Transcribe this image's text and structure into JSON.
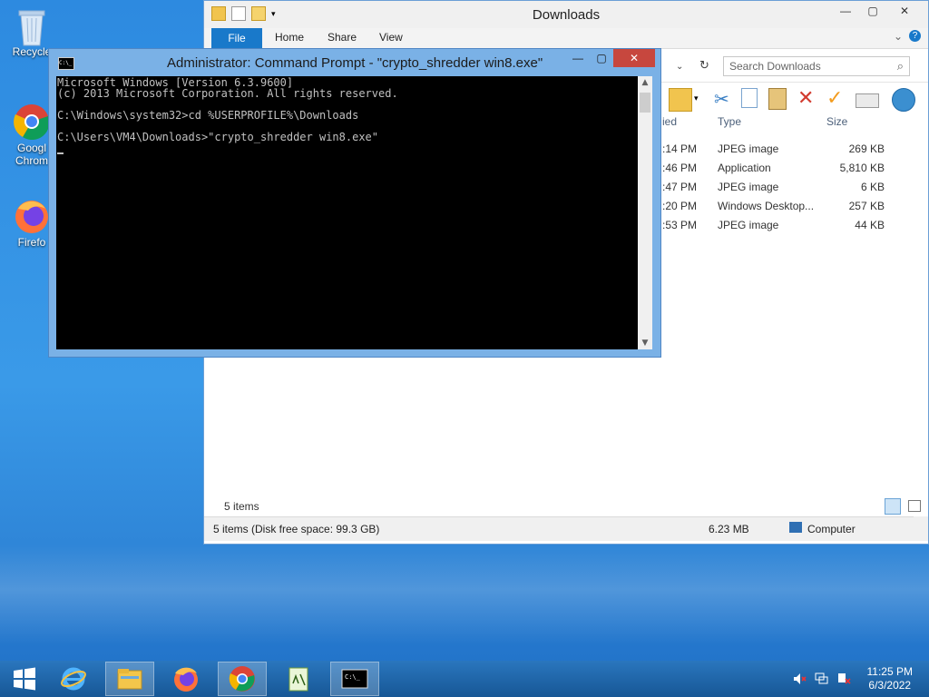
{
  "desktop": {
    "icons": [
      {
        "label": "Recycle",
        "icon": "recycle-bin-icon"
      },
      {
        "label": "Googl\nChrom",
        "icon": "chrome-icon"
      },
      {
        "label": "Firefo",
        "icon": "firefox-icon"
      }
    ]
  },
  "explorer": {
    "title": "Downloads",
    "ribbon": {
      "file": "File",
      "home": "Home",
      "share": "Share",
      "view": "View"
    },
    "search_placeholder": "Search Downloads",
    "columns": {
      "modified": "ied",
      "type": "Type",
      "size": "Size"
    },
    "rows": [
      {
        "time": ":14 PM",
        "type": "JPEG image",
        "size": "269 KB"
      },
      {
        "time": ":46 PM",
        "type": "Application",
        "size": "5,810 KB"
      },
      {
        "time": ":47 PM",
        "type": "JPEG image",
        "size": "6 KB"
      },
      {
        "time": ":20 PM",
        "type": "Windows Desktop...",
        "size": "257 KB"
      },
      {
        "time": ":53 PM",
        "type": "JPEG image",
        "size": "44 KB"
      }
    ],
    "item_count": "5 items",
    "status_left": "5 items (Disk free space: 99.3 GB)",
    "status_size": "6.23 MB",
    "status_location": "Computer"
  },
  "cmd": {
    "title": "Administrator: Command Prompt - \"crypto_shredder win8.exe\"",
    "icon_text": "C:\\_",
    "lines": [
      "Microsoft Windows [Version 6.3.9600]",
      "(c) 2013 Microsoft Corporation. All rights reserved.",
      "",
      "C:\\Windows\\system32>cd %USERPROFILE%\\Downloads",
      "",
      "C:\\Users\\VM4\\Downloads>\"crypto_shredder win8.exe\""
    ]
  },
  "taskbar": {
    "items": [
      "start-icon",
      "internet-explorer-icon",
      "file-explorer-icon",
      "firefox-icon",
      "chrome-icon",
      "notepad-icon",
      "command-prompt-icon"
    ],
    "time": "11:25 PM",
    "date": "6/3/2022"
  },
  "colors": {
    "accent": "#1979ca",
    "close": "#c7473e",
    "console_bg": "#000000",
    "console_fg": "#c0c0c0"
  }
}
